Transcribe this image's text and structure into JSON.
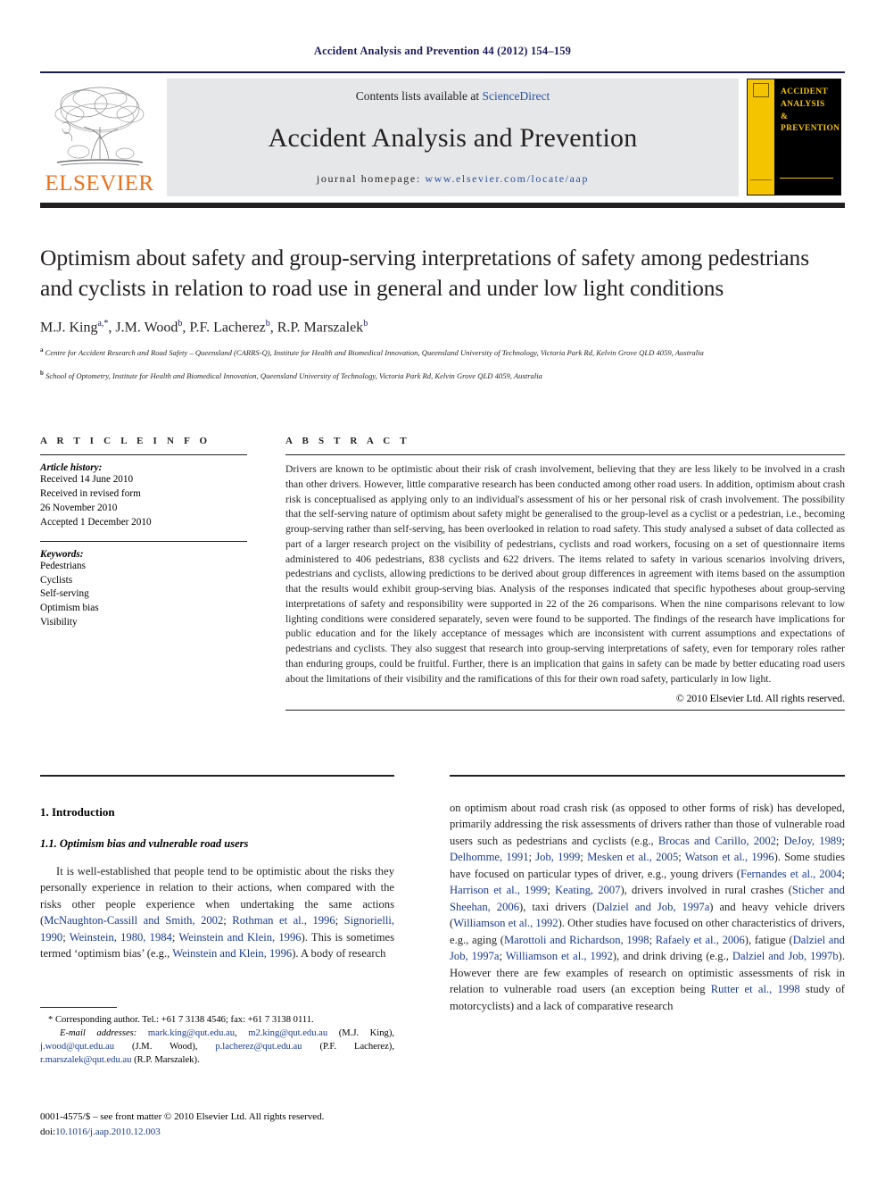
{
  "running_head": "Accident Analysis and Prevention 44 (2012) 154–159",
  "masthead": {
    "contents_prefix": "Contents lists available at ",
    "contents_link": "ScienceDirect",
    "journal_title": "Accident Analysis and Prevention",
    "homepage_prefix": "journal homepage: ",
    "homepage_url": "www.elsevier.com/locate/aap",
    "publisher_wordmark": "ELSEVIER",
    "cover_title": "ACCIDENT ANALYSIS & PREVENTION",
    "cover_title_lines": [
      "ACCIDENT",
      "ANALYSIS",
      "&",
      "PREVENTION"
    ],
    "accent_orange": "#E9711C",
    "accent_blue": "#2b53a4",
    "cover_yellow": "#F5C400"
  },
  "article": {
    "title": "Optimism about safety and group-serving interpretations of safety among pedestrians and cyclists in relation to road use in general and under low light conditions",
    "authors_html": "M.J. King<sup>a,*</sup>, J.M. Wood<sup>b</sup>, P.F. Lacherez<sup>b</sup>, R.P. Marszalek<sup>b</sup>",
    "affiliation_a": "Centre for Accident Research and Road Safety – Queensland (CARRS-Q), Institute for Health and Biomedical Innovation, Queensland University of Technology, Victoria Park Rd, Kelvin Grove QLD 4059, Australia",
    "affiliation_b": "School of Optometry, Institute for Health and Biomedical Innovation, Queensland University of Technology, Victoria Park Rd, Kelvin Grove QLD 4059, Australia"
  },
  "info": {
    "heading": "A R T I C L E   I N F O",
    "history_label": "Article history:",
    "history_lines": [
      "Received 14 June 2010",
      "Received in revised form",
      "26 November 2010",
      "Accepted 1 December 2010"
    ],
    "keywords_label": "Keywords:",
    "keywords": [
      "Pedestrians",
      "Cyclists",
      "Self-serving",
      "Optimism bias",
      "Visibility"
    ]
  },
  "abstract": {
    "heading": "A B S T R A C T",
    "text": "Drivers are known to be optimistic about their risk of crash involvement, believing that they are less likely to be involved in a crash than other drivers. However, little comparative research has been conducted among other road users. In addition, optimism about crash risk is conceptualised as applying only to an individual's assessment of his or her personal risk of crash involvement. The possibility that the self-serving nature of optimism about safety might be generalised to the group-level as a cyclist or a pedestrian, i.e., becoming group-serving rather than self-serving, has been overlooked in relation to road safety. This study analysed a subset of data collected as part of a larger research project on the visibility of pedestrians, cyclists and road workers, focusing on a set of questionnaire items administered to 406 pedestrians, 838 cyclists and 622 drivers. The items related to safety in various scenarios involving drivers, pedestrians and cyclists, allowing predictions to be derived about group differences in agreement with items based on the assumption that the results would exhibit group-serving bias. Analysis of the responses indicated that specific hypotheses about group-serving interpretations of safety and responsibility were supported in 22 of the 26 comparisons. When the nine comparisons relevant to low lighting conditions were considered separately, seven were found to be supported. The findings of the research have implications for public education and for the likely acceptance of messages which are inconsistent with current assumptions and expectations of pedestrians and cyclists. They also suggest that research into group-serving interpretations of safety, even for temporary roles rather than enduring groups, could be fruitful. Further, there is an implication that gains in safety can be made by better educating road users about the limitations of their visibility and the ramifications of this for their own road safety, particularly in low light.",
    "copyright": "© 2010 Elsevier Ltd. All rights reserved."
  },
  "body": {
    "section_1": "1. Introduction",
    "subsection_1_1": "1.1. Optimism bias and vulnerable road users",
    "left_paragraph_html": "It is well-established that people tend to be optimistic about the risks they personally experience in relation to their actions, when compared with the risks other people experience when undertaking the same actions (<a class=\"ref\" href=\"#\">McNaughton-Cassill and Smith, 2002</a>; <a class=\"ref\" href=\"#\">Rothman et al., 1996</a>; <a class=\"ref\" href=\"#\">Signorielli, 1990</a>; <a class=\"ref\" href=\"#\">Weinstein, 1980, 1984</a>; <a class=\"ref\" href=\"#\">Weinstein and Klein, 1996</a>). This is sometimes termed ‘optimism bias’ (e.g., <a class=\"ref\" href=\"#\">Weinstein and Klein, 1996</a>). A body of research",
    "right_paragraph_html": "on optimism about road crash risk (as opposed to other forms of risk) has developed, primarily addressing the risk assessments of drivers rather than those of vulnerable road users such as pedestrians and cyclists (e.g., <a class=\"ref\" href=\"#\">Brocas and Carillo, 2002</a>; <a class=\"ref\" href=\"#\">DeJoy, 1989</a>; <a class=\"ref\" href=\"#\">Delhomme, 1991</a>; <a class=\"ref\" href=\"#\">Job, 1999</a>; <a class=\"ref\" href=\"#\">Mesken et al., 2005</a>; <a class=\"ref\" href=\"#\">Watson et al., 1996</a>). Some studies have focused on particular types of driver, e.g., young drivers (<a class=\"ref\" href=\"#\">Fernandes et al., 2004</a>; <a class=\"ref\" href=\"#\">Harrison et al., 1999</a>; <a class=\"ref\" href=\"#\">Keating, 2007</a>), drivers involved in rural crashes (<a class=\"ref\" href=\"#\">Sticher and Sheehan, 2006</a>), taxi drivers (<a class=\"ref\" href=\"#\">Dalziel and Job, 1997a</a>) and heavy vehicle drivers (<a class=\"ref\" href=\"#\">Williamson et al., 1992</a>). Other studies have focused on other characteristics of drivers, e.g., aging (<a class=\"ref\" href=\"#\">Marottoli and Richardson, 1998</a>; <a class=\"ref\" href=\"#\">Rafaely et al., 2006</a>), fatigue (<a class=\"ref\" href=\"#\">Dalziel and Job, 1997a</a>; <a class=\"ref\" href=\"#\">Williamson et al., 1992</a>), and drink driving (e.g., <a class=\"ref\" href=\"#\">Dalziel and Job, 1997b</a>). However there are few examples of research on optimistic assessments of risk in relation to vulnerable road users (an exception being <a class=\"ref\" href=\"#\">Rutter et al., 1998</a> study of motorcyclists) and a lack of comparative research"
  },
  "footnotes": {
    "corresponding_html": "* Corresponding author. Tel.: +61 7 3138 4546; fax: +61 7 3138 0111.",
    "emails_html": "<em>E-mail addresses:</em> <a class=\"ref\" href=\"#\">mark.king@qut.edu.au</a>, <a class=\"ref\" href=\"#\">m2.king@qut.edu.au</a> (M.J. King), <a class=\"ref\" href=\"#\">j.wood@qut.edu.au</a> (J.M. Wood), <a class=\"ref\" href=\"#\">p.lacherez@qut.edu.au</a> (P.F. Lacherez), <a class=\"ref\" href=\"#\">r.marszalek@qut.edu.au</a> (R.P. Marszalek).",
    "issn_html": "0001-4575/$ – see front matter © 2010 Elsevier Ltd. All rights reserved.<br>doi:<a class=\"ref\" href=\"#\">10.1016/j.aap.2010.12.003</a>"
  }
}
